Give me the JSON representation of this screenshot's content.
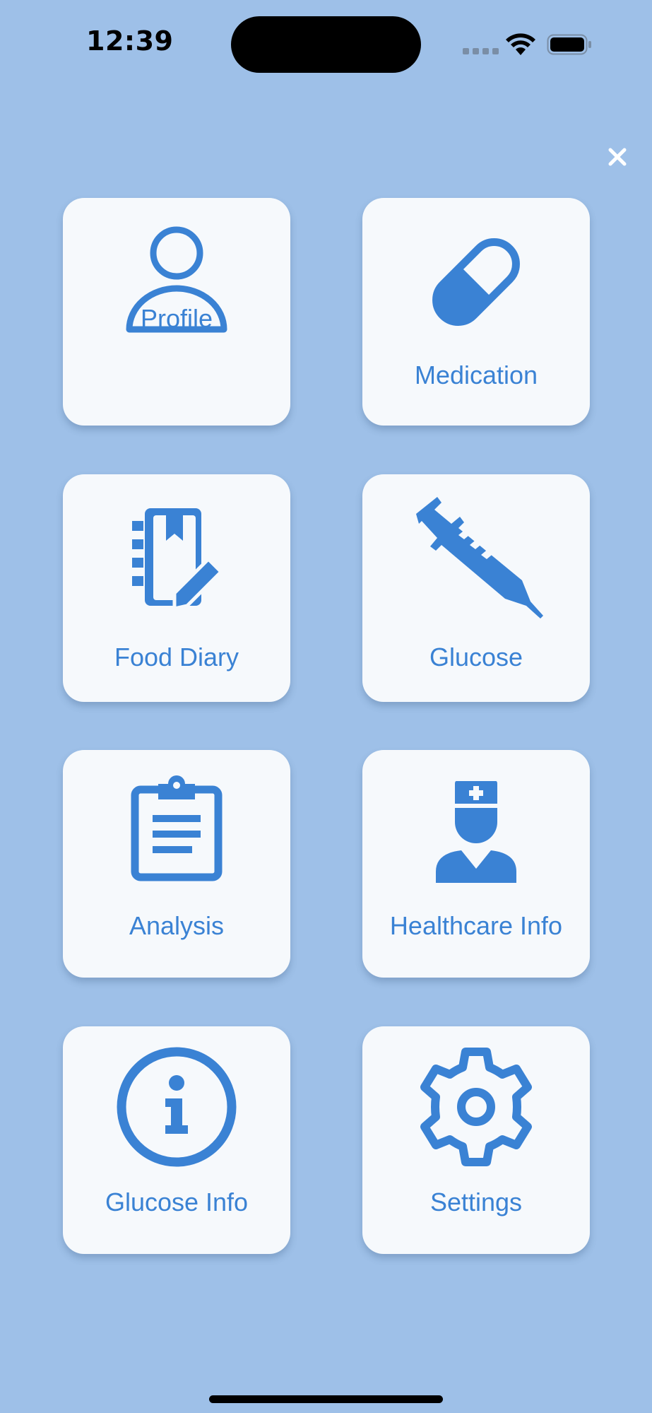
{
  "status_bar": {
    "time": "12:39"
  },
  "menu": {
    "close_icon": "close-icon",
    "accent_color": "#3A82D4",
    "background_color": "#9EC0E8",
    "tile_color": "#F6F9FC",
    "items": [
      {
        "label": "Profile",
        "icon": "person-icon"
      },
      {
        "label": "Medication",
        "icon": "pill-icon"
      },
      {
        "label": "Food Diary",
        "icon": "notebook-pencil-icon"
      },
      {
        "label": "Glucose",
        "icon": "syringe-icon"
      },
      {
        "label": "Analysis",
        "icon": "clipboard-icon"
      },
      {
        "label": "Healthcare Info",
        "icon": "doctor-icon"
      },
      {
        "label": "Glucose Info",
        "icon": "info-icon"
      },
      {
        "label": "Settings",
        "icon": "gear-icon"
      }
    ]
  }
}
